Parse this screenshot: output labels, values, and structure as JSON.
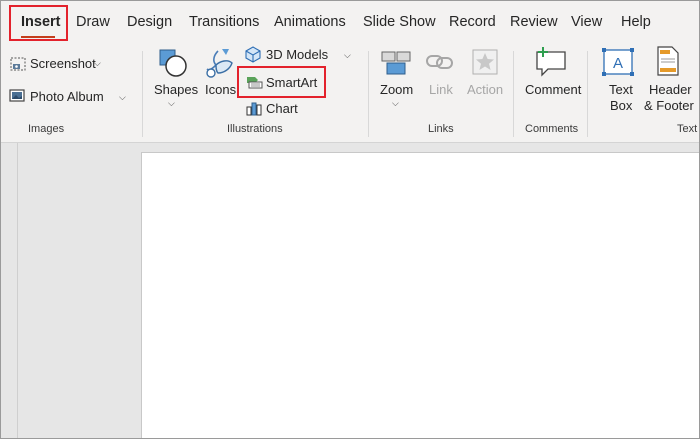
{
  "tabs": [
    "Insert",
    "Draw",
    "Design",
    "Transitions",
    "Animations",
    "Slide Show",
    "Record",
    "Review",
    "View",
    "Help"
  ],
  "active_tab": "Insert",
  "accent_color": "#c43e1c",
  "highlight_color": "#e3222c",
  "groups": {
    "images": {
      "label": "Images",
      "screenshot": "Screenshot",
      "photo_album": "Photo Album"
    },
    "illustrations": {
      "label": "Illustrations",
      "shapes": "Shapes",
      "icons": "Icons",
      "models_3d": "3D Models",
      "smartart": "SmartArt",
      "chart": "Chart"
    },
    "links": {
      "label": "Links",
      "zoom": "Zoom",
      "link": "Link",
      "action": "Action"
    },
    "comments": {
      "label": "Comments",
      "comment": "Comment"
    },
    "text": {
      "label": "Text",
      "text_box_line1": "Text",
      "text_box_line2": "Box",
      "header_footer_line1": "Header",
      "header_footer_line2": "& Footer"
    }
  }
}
